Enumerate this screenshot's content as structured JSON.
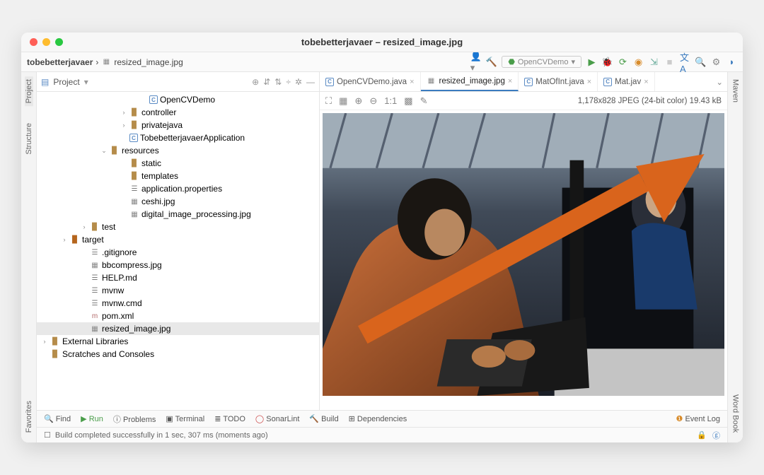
{
  "window": {
    "title": "tobebetterjavaer – resized_image.jpg"
  },
  "breadcrumb": {
    "root": "tobebetterjavaer",
    "file": "resized_image.jpg"
  },
  "runConfig": "OpenCVDemo",
  "projectPanel": {
    "title": "Project"
  },
  "tree": {
    "items": [
      {
        "depth": 10,
        "icon": "java",
        "label": "OpenCVDemo"
      },
      {
        "depth": 8,
        "tw": "›",
        "icon": "fold",
        "label": "controller"
      },
      {
        "depth": 8,
        "tw": "›",
        "icon": "fold",
        "label": "privatejava"
      },
      {
        "depth": 8,
        "icon": "java",
        "label": "TobebetterjavaerApplication"
      },
      {
        "depth": 6,
        "tw": "⌄",
        "icon": "fold",
        "label": "resources"
      },
      {
        "depth": 8,
        "icon": "fold",
        "label": "static"
      },
      {
        "depth": 8,
        "icon": "fold",
        "label": "templates"
      },
      {
        "depth": 8,
        "icon": "file",
        "label": "application.properties"
      },
      {
        "depth": 8,
        "icon": "img",
        "label": "ceshi.jpg"
      },
      {
        "depth": 8,
        "icon": "img",
        "label": "digital_image_processing.jpg"
      },
      {
        "depth": 4,
        "tw": "›",
        "icon": "fold",
        "label": "test"
      },
      {
        "depth": 2,
        "tw": "›",
        "icon": "fold",
        "label": "target",
        "brown": true
      },
      {
        "depth": 4,
        "icon": "file",
        "label": ".gitignore"
      },
      {
        "depth": 4,
        "icon": "img",
        "label": "bbcompress.jpg"
      },
      {
        "depth": 4,
        "icon": "file",
        "label": "HELP.md"
      },
      {
        "depth": 4,
        "icon": "file",
        "label": "mvnw"
      },
      {
        "depth": 4,
        "icon": "file",
        "label": "mvnw.cmd"
      },
      {
        "depth": 4,
        "icon": "xml",
        "label": "pom.xml"
      },
      {
        "depth": 4,
        "icon": "img",
        "label": "resized_image.jpg",
        "sel": true
      },
      {
        "depth": 0,
        "tw": "›",
        "icon": "fold",
        "label": "External Libraries"
      },
      {
        "depth": 0,
        "icon": "fold",
        "label": "Scratches and Consoles"
      }
    ]
  },
  "editorTabs": [
    {
      "label": "OpenCVDemo.java",
      "icon": "java"
    },
    {
      "label": "resized_image.jpg",
      "icon": "img",
      "active": true
    },
    {
      "label": "MatOfInt.java",
      "icon": "java"
    },
    {
      "label": "Mat.jav",
      "icon": "java"
    }
  ],
  "imageInfo": "1,178x828 JPEG (24-bit color) 19.43 kB",
  "leftTabs": [
    "Project",
    "Structure",
    "Favorites"
  ],
  "rightTabs": [
    "Maven",
    "Word Book"
  ],
  "bottomTools": {
    "find": "Find",
    "run": "Run",
    "problems": "Problems",
    "terminal": "Terminal",
    "todo": "TODO",
    "sonar": "SonarLint",
    "build": "Build",
    "deps": "Dependencies",
    "eventLog": "Event Log"
  },
  "status": {
    "msg": "Build completed successfully in 1 sec, 307 ms (moments ago)"
  }
}
